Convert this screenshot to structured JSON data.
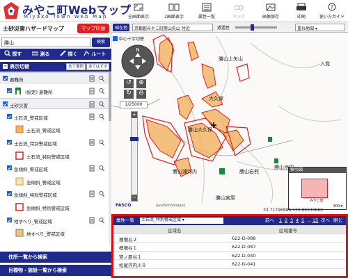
{
  "header": {
    "title": "みやこ町Webマップ",
    "subtitle": "Miyako Town Web Map",
    "toolbar": [
      {
        "label": "全画面表示",
        "icon": "fullscreen-icon"
      },
      {
        "label": "2画面表示",
        "icon": "split-screen-icon"
      },
      {
        "label": "属性一覧",
        "icon": "attribute-list-icon"
      },
      {
        "label": "リンク",
        "icon": "link-icon",
        "disabled": true
      },
      {
        "label": "画像保存",
        "icon": "save-image-icon"
      },
      {
        "label": "印刷",
        "icon": "print-icon"
      },
      {
        "label": "使い方ガイド",
        "icon": "guide-icon"
      }
    ]
  },
  "sidebar": {
    "title": "土砂災害ハザードマップ",
    "map_switch": "マップ切替",
    "search": {
      "value": "勝山",
      "button": "検索"
    },
    "tools": [
      "探す",
      "測る",
      "描く",
      "ルート"
    ],
    "show_header": "表示切替",
    "select_all": "全て選択",
    "clear_all": "全てはずす",
    "layers": [
      {
        "label": "避難所",
        "level": 0,
        "group": true
      },
      {
        "label": "(指定) 避難所",
        "level": 1,
        "swatch": "shelter"
      },
      {
        "label": "土砂災害",
        "level": 0,
        "group": true
      },
      {
        "label": "土石流_警戒区域",
        "level": 1
      },
      {
        "label": "土石流_警戒区域",
        "level": 2,
        "swatch": "orange-fill"
      },
      {
        "label": "土石流_特別警戒区域",
        "level": 1
      },
      {
        "label": "土石流_特別警戒区域",
        "level": 2,
        "swatch": "red-outline"
      },
      {
        "label": "急傾斜_警戒区域",
        "level": 1
      },
      {
        "label": "急傾斜_警戒区域",
        "level": 2,
        "swatch": "yellow-fill"
      },
      {
        "label": "急傾斜_特別警戒区域",
        "level": 1
      },
      {
        "label": "急傾斜_特別警戒区域",
        "level": 2,
        "swatch": "red-outline"
      },
      {
        "label": "地すべり_警戒区域",
        "level": 1
      },
      {
        "label": "地すべり_警戒区域",
        "level": 2,
        "swatch": "brown-fill"
      }
    ],
    "link1": "住所一覧から検索",
    "link2": "目標物・施設一覧から検索"
  },
  "map": {
    "current_label": "現在地",
    "address": "京都郡みやこ町勝山矢山 付近",
    "opacity_label": "透過性",
    "basemap": "重ね地図",
    "north_chk": "中心十字切替",
    "scale": "1/25000",
    "places": [
      "勝山上矢山",
      "入覚",
      "勝山大久保",
      "勝山池田",
      "勝山浦河内",
      "勝山岩熊",
      "勝山宮原",
      "大久保"
    ],
    "coords": "33.71796889,130.89130880",
    "credits": [
      "PASCO",
      "GeoTechnologies"
    ],
    "index": {
      "label": "索引図",
      "scale": "300m",
      "place": "みやこ町"
    }
  },
  "attr": {
    "title": "属性一覧",
    "layer": "土石流_特別警戒区域",
    "prev": "前へ",
    "pages": [
      "1",
      "2",
      "3",
      "4",
      "5"
    ],
    "ellipsis": "…",
    "last": "15",
    "next": "次へ",
    "close": "閉じ",
    "columns": [
      "区域名",
      "区域番号"
    ],
    "rows": [
      [
        "檀増谷２",
        "622-D-088"
      ],
      [
        "檀増谷１",
        "622-D-087"
      ],
      [
        "宮ノ原谷１",
        "622-D-040"
      ],
      [
        "松尾河内川８",
        "622-D-041"
      ]
    ]
  }
}
